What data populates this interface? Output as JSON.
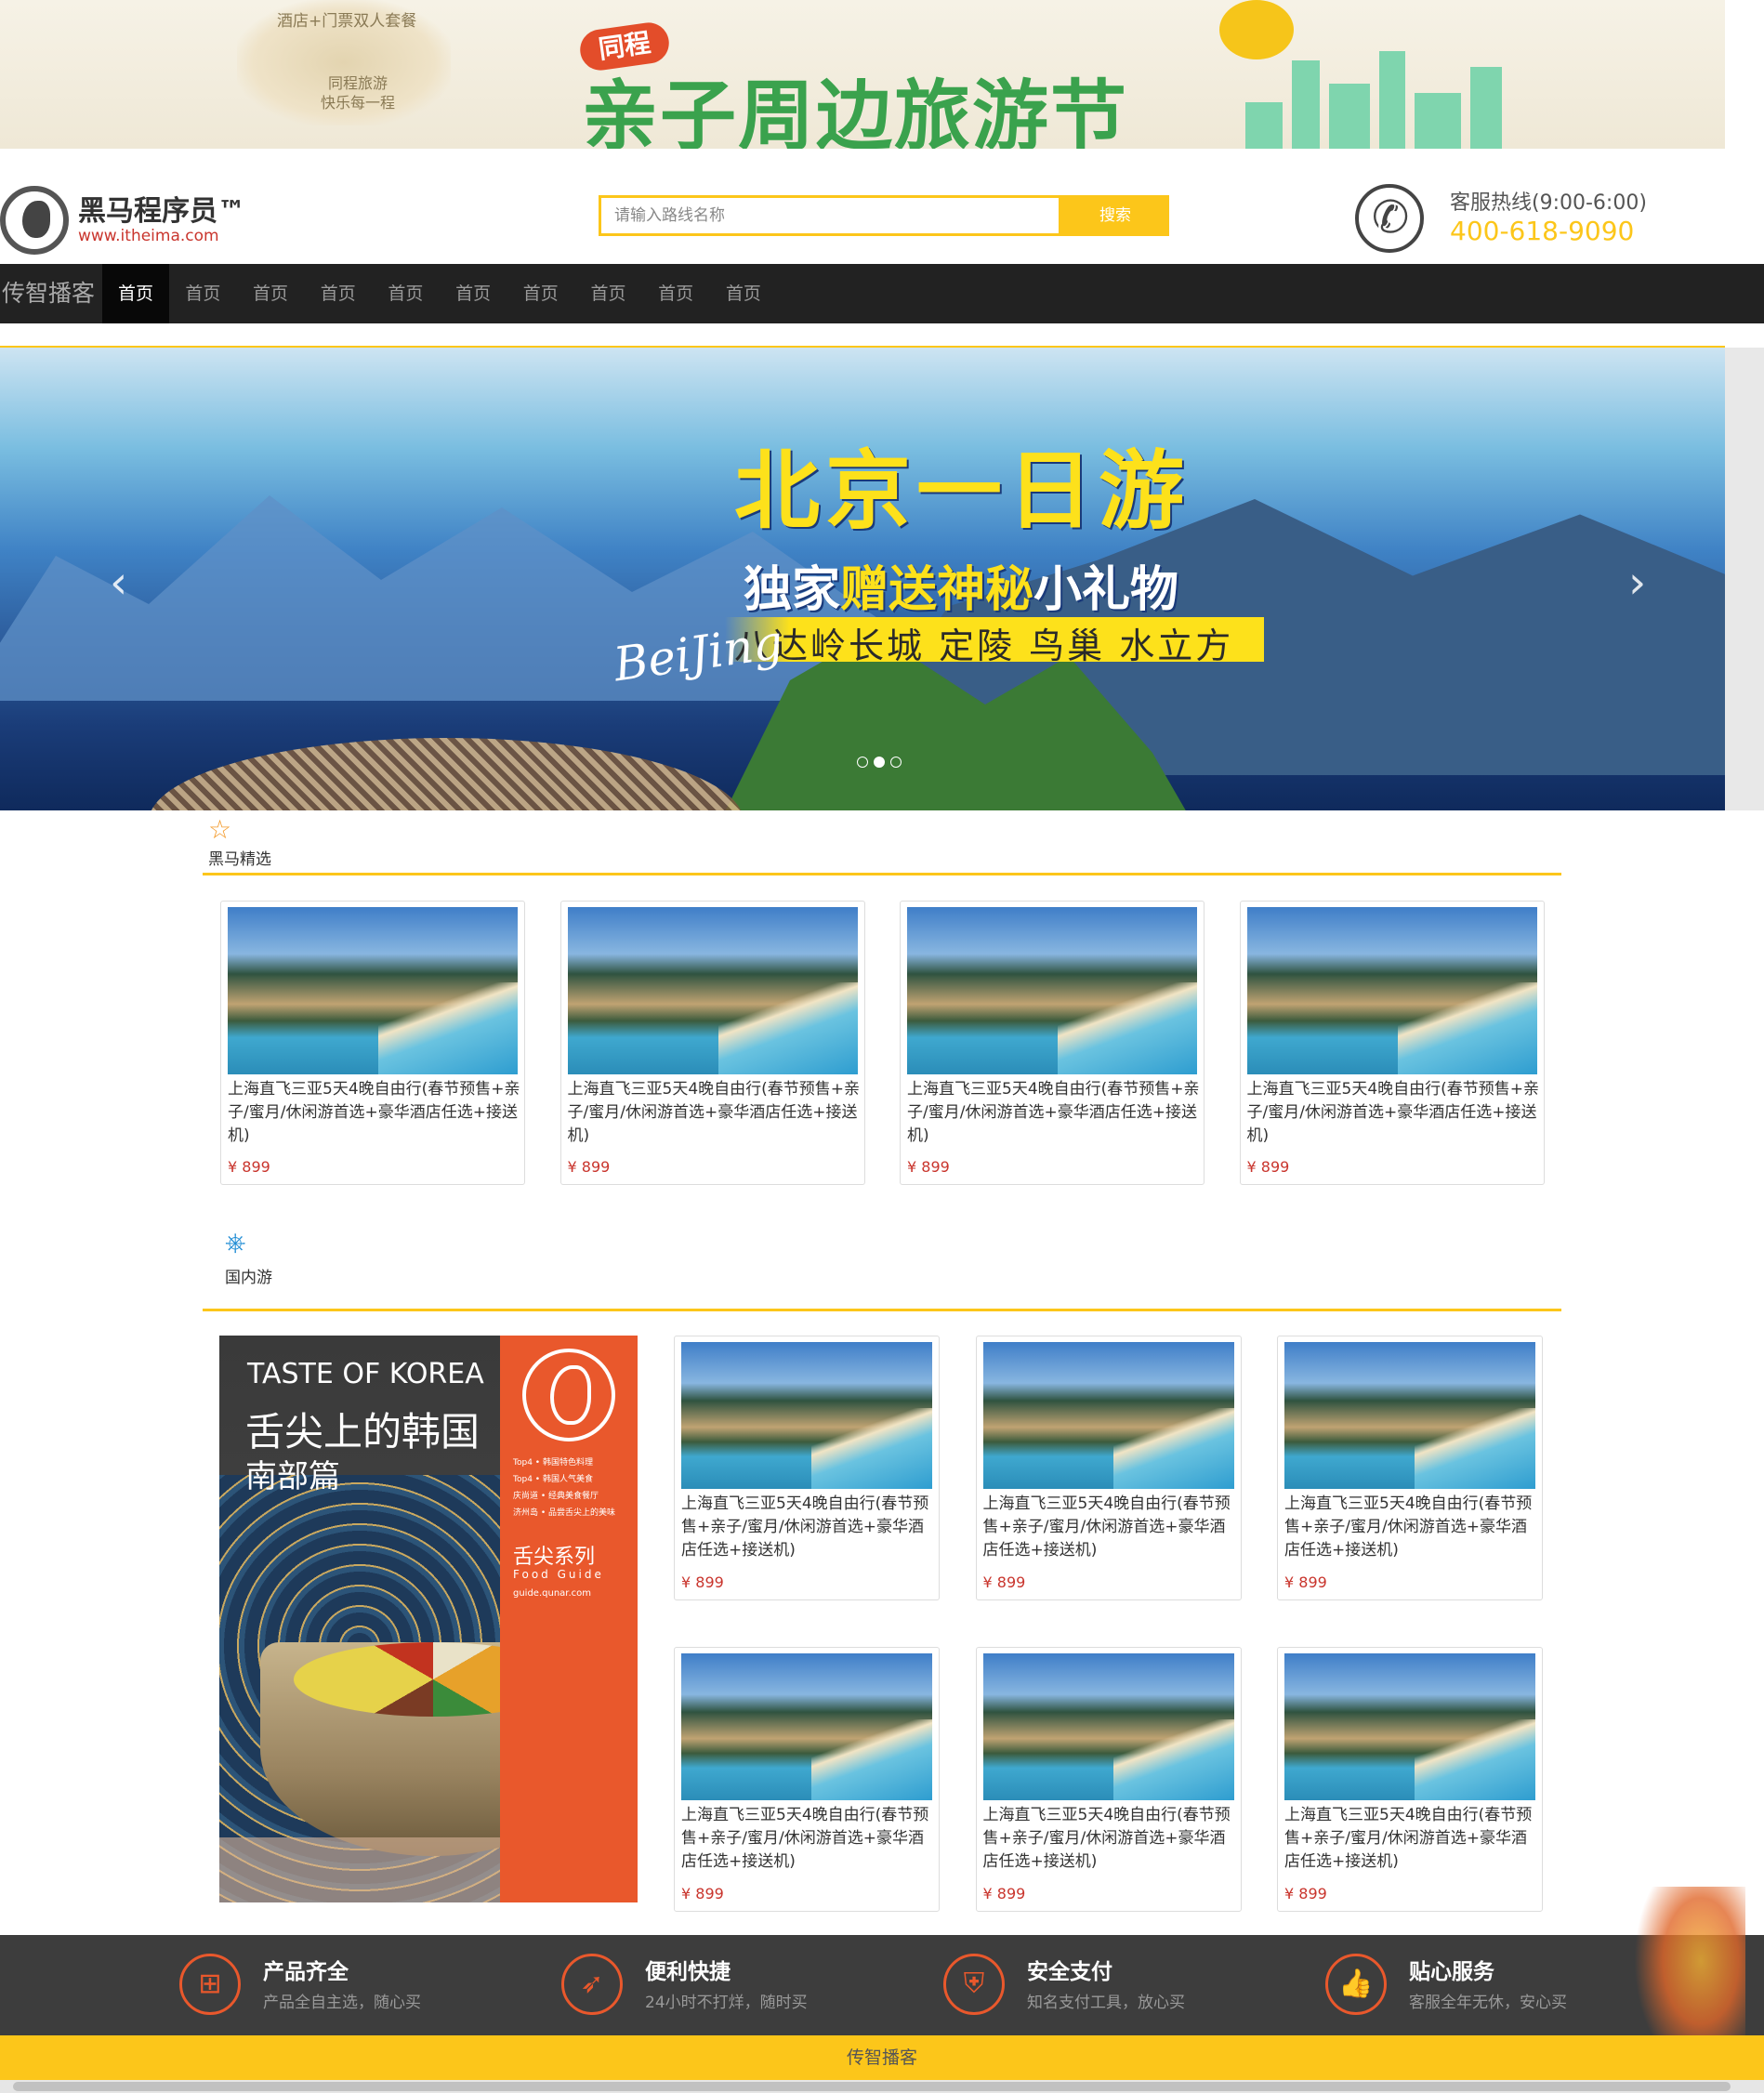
{
  "promo": {
    "tag_line1": "酒店+门票双人套餐",
    "tag_line2": "同程旅游",
    "tag_line3": "快乐每一程",
    "brand_badge": "同程",
    "festival_title": "亲子周边旅游节"
  },
  "header": {
    "logo_cn": "黑马程序员™",
    "logo_en": "www.itheima.com",
    "search_placeholder": "请输入路线名称",
    "search_button": "搜索",
    "hotline_label": "客服热线(9:00-6:00)",
    "hotline_number": "400-618-9090"
  },
  "nav": {
    "brand": "传智播客",
    "items": [
      "首页",
      "首页",
      "首页",
      "首页",
      "首页",
      "首页",
      "首页",
      "首页",
      "首页",
      "首页"
    ]
  },
  "hero": {
    "title": "北京一日游",
    "subtitle_prefix": "独家",
    "subtitle_highlight": "赠送神秘",
    "subtitle_suffix": "小礼物",
    "places": "八达岭长城 定陵 鸟巢 水立方",
    "beijing": "BeiJing",
    "prev_arrow": "‹",
    "next_arrow": "›",
    "slide_count": 3,
    "active_slide": 2
  },
  "sections": {
    "selected_title": "黑马精选",
    "selected_icon": "star-icon",
    "domestic_title": "国内游",
    "domestic_icon": "ferris-wheel-icon"
  },
  "selected_cards": [
    {
      "name": "上海直飞三亚5天4晚自由行(春节预售+亲子/蜜月/休闲游首选+豪华酒店任选+接送机)",
      "price": "¥ 899"
    },
    {
      "name": "上海直飞三亚5天4晚自由行(春节预售+亲子/蜜月/休闲游首选+豪华酒店任选+接送机)",
      "price": "¥ 899"
    },
    {
      "name": "上海直飞三亚5天4晚自由行(春节预售+亲子/蜜月/休闲游首选+豪华酒店任选+接送机)",
      "price": "¥ 899"
    },
    {
      "name": "上海直飞三亚5天4晚自由行(春节预售+亲子/蜜月/休闲游首选+豪华酒店任选+接送机)",
      "price": "¥ 899"
    }
  ],
  "domestic_cards": [
    {
      "name": "上海直飞三亚5天4晚自由行(春节预售+亲子/蜜月/休闲游首选+豪华酒店任选+接送机)",
      "price": "¥ 899"
    },
    {
      "name": "上海直飞三亚5天4晚自由行(春节预售+亲子/蜜月/休闲游首选+豪华酒店任选+接送机)",
      "price": "¥ 899"
    },
    {
      "name": "上海直飞三亚5天4晚自由行(春节预售+亲子/蜜月/休闲游首选+豪华酒店任选+接送机)",
      "price": "¥ 899"
    },
    {
      "name": "上海直飞三亚5天4晚自由行(春节预售+亲子/蜜月/休闲游首选+豪华酒店任选+接送机)",
      "price": "¥ 899"
    },
    {
      "name": "上海直飞三亚5天4晚自由行(春节预售+亲子/蜜月/休闲游首选+豪华酒店任选+接送机)",
      "price": "¥ 899"
    },
    {
      "name": "上海直飞三亚5天4晚自由行(春节预售+亲子/蜜月/休闲游首选+豪华酒店任选+接送机)",
      "price": "¥ 899"
    }
  ],
  "feature": {
    "en": "TASTE OF KOREA",
    "cn": "舌尖上的韩国",
    "sub": "南部篇",
    "ob_lines": "Top4 • 韩国特色料理\nTop4 • 韩国人气美食\n庆尚道 • 经典美食餐厅\n济州岛 • 品尝舌尖上的美味",
    "series": "舌尖系列",
    "food_guide": "Food Guide",
    "url": "guide.qunar.com"
  },
  "services": [
    {
      "icon": "grid-icon",
      "title": "产品齐全",
      "desc": "产品全自主选，随心买"
    },
    {
      "icon": "rocket-icon",
      "title": "便利快捷",
      "desc": "24小时不打烊，随时买"
    },
    {
      "icon": "shield-icon",
      "title": "安全支付",
      "desc": "知名支付工具，放心买"
    },
    {
      "icon": "thumbs-up-icon",
      "title": "贴心服务",
      "desc": "客服全年无休，安心买"
    }
  ],
  "footer": {
    "text": "传智播客"
  },
  "colors": {
    "accent": "#fcc61a",
    "price": "#c9352d",
    "nav_bg": "#222222",
    "service_icon": "#e9582c"
  }
}
